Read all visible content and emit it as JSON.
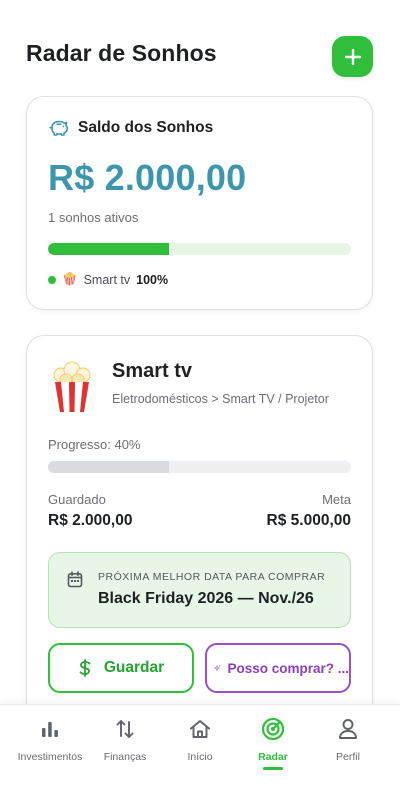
{
  "header": {
    "title": "Radar de Sonhos",
    "add_icon": "plus-icon"
  },
  "balance_card": {
    "icon": "piggy-bank-icon",
    "title": "Saldo dos Sonhos",
    "value": "R$ 2.000,00",
    "active_count": "1 sonhos ativos",
    "progress_fraction": 0.4,
    "legend": {
      "emoji": "🍿",
      "name": "Smart tv",
      "percent": "100%"
    }
  },
  "dream_card": {
    "emoji": "🍿",
    "name": "Smart tv",
    "category": "Eletrodomésticos > Smart TV / Projetor",
    "progress_label": "Progresso: 40%",
    "progress_fraction": 0.4,
    "saved_label": "Guardado",
    "saved_value": "R$ 2.000,00",
    "goal_label": "Meta",
    "goal_value": "R$ 5.000,00",
    "best_date": {
      "icon": "calendar-icon",
      "label": "PRÓXIMA MELHOR DATA PARA COMPRAR",
      "value": "Black Friday 2026 — Nov./26"
    },
    "save_button": {
      "icon": "dollar-icon",
      "label": "Guardar"
    },
    "buy_button": {
      "icon": "sparkles-icon",
      "label": "Posso comprar? ..."
    }
  },
  "bottom_nav": {
    "items": [
      {
        "label": "Investimentos",
        "icon": "bar-chart-icon",
        "active": false
      },
      {
        "label": "Finanças",
        "icon": "arrows-up-down-icon",
        "active": false
      },
      {
        "label": "Início",
        "icon": "home-icon",
        "active": false
      },
      {
        "label": "Radar",
        "icon": "radar-icon",
        "active": true
      },
      {
        "label": "Perfil",
        "icon": "user-icon",
        "active": false
      }
    ]
  },
  "colors": {
    "brand_green": "#2fbf3a",
    "balance_blue": "#3c97ae",
    "purple": "#9b4fc9"
  }
}
